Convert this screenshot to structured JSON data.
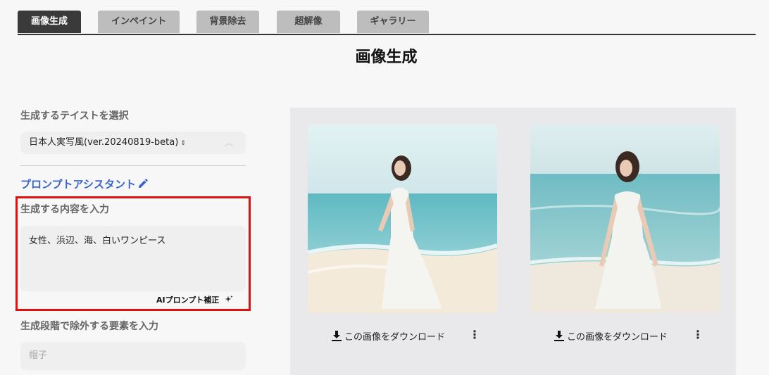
{
  "tabs": [
    {
      "label": "画像生成",
      "active": true
    },
    {
      "label": "インペイント",
      "active": false
    },
    {
      "label": "背景除去",
      "active": false
    },
    {
      "label": "超解像",
      "active": false
    },
    {
      "label": "ギャラリー",
      "active": false
    }
  ],
  "page_title": "画像生成",
  "taste": {
    "label": "生成するテイストを選択",
    "selected": "日本人実写風(ver.20240819-beta)",
    "updown_icon": "⇕",
    "chevron": "︿"
  },
  "prompt_assistant": {
    "label": "プロンプトアシスタント",
    "icon": "pencil-icon",
    "color": "#3b65c9"
  },
  "prompt": {
    "label": "生成する内容を入力",
    "value": "女性、浜辺、海、白いワンピース",
    "ai_fix_label": "AIプロンプト補正",
    "ai_fix_icon": "sparkle-icon"
  },
  "negative": {
    "label": "生成段階で除外する要素を入力",
    "placeholder": "帽子"
  },
  "results": [
    {
      "download_label": "この画像をダウンロード",
      "more": "⋮"
    },
    {
      "download_label": "この画像をダウンロード",
      "more": "⋮"
    }
  ],
  "colors": {
    "highlight": "#e01010",
    "active_tab": "#3a3a3a",
    "link": "#3b65c9"
  }
}
